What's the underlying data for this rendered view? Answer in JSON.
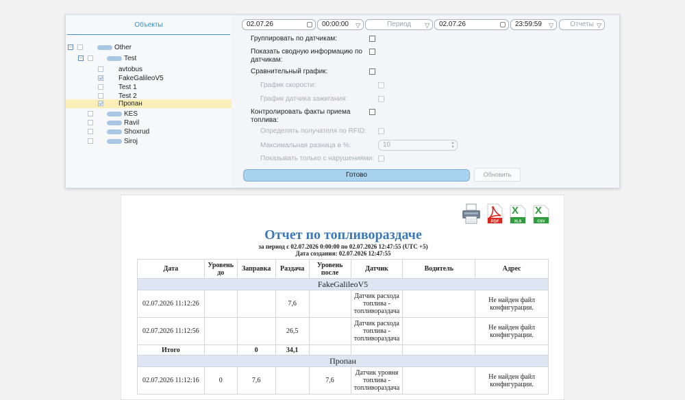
{
  "tree": {
    "tab_label": "Объекты",
    "items": [
      {
        "label": "Other",
        "level": 0,
        "expander": "⊟",
        "checked": false,
        "group": true
      },
      {
        "label": "Test",
        "level": 1,
        "expander": "⊟",
        "checked": false,
        "group": true
      },
      {
        "label": "avtobus",
        "level": 2,
        "checked": false,
        "group": false
      },
      {
        "label": "FakeGalileoV5",
        "level": 2,
        "checked": true,
        "group": false
      },
      {
        "label": "Test 1",
        "level": 2,
        "checked": false,
        "group": false
      },
      {
        "label": "Test 2",
        "level": 2,
        "checked": false,
        "group": false
      },
      {
        "label": "Пропан",
        "level": 2,
        "checked": true,
        "group": false,
        "selected": true
      },
      {
        "label": "KES",
        "level": 1,
        "checked": false,
        "group": true
      },
      {
        "label": "Ravil",
        "level": 1,
        "checked": false,
        "group": true
      },
      {
        "label": "Shoxrud",
        "level": 1,
        "checked": false,
        "group": true
      },
      {
        "label": "Siroj",
        "level": 1,
        "checked": false,
        "group": true
      }
    ]
  },
  "filters": {
    "date_from": "02.07.26",
    "time_from": "00:00:00",
    "period_placeholder": "Период",
    "date_to": "02.07.26",
    "time_to": "23:59:59",
    "reports_placeholder": "Отчеты"
  },
  "options": {
    "group_by_sensors": "Группировать по датчикам:",
    "summary": "Показать сводную информацию по датчикам:",
    "compare_chart": "Сравнительный график:",
    "speed_chart": "График скорости:",
    "ignition_chart": "График датчика зажигания:",
    "control_fuel": "Контролировать факты приема топлива:",
    "rfid_receiver": "Определять получателя по RFID:",
    "max_diff": "Максимальная разница в %:",
    "max_diff_value": "10",
    "violations_only": "Показывать только с нарушениями:",
    "ready_button": "Готово",
    "refresh_button": "Обновить"
  },
  "report": {
    "title": "Отчет по топливораздаче",
    "period": "за период с 02.07.2026 0:00:00 по 02.07.2026 12:47:55 (UTC +5)",
    "created": "Дата создания: 02.07.2026 12:47:55",
    "export_icons": [
      "printer-icon",
      "pdf-icon",
      "xls-icon",
      "csv-icon"
    ],
    "columns": [
      "Дата",
      "Уровень до",
      "Заправка",
      "Раздача",
      "Уровень после",
      "Датчик",
      "Водитель",
      "Адрес"
    ],
    "groups": [
      {
        "name": "FakeGalileoV5",
        "rows": [
          [
            "02.07.2026 11:12:26",
            "",
            "",
            "7,6",
            "",
            "Датчик расхода топлива - топливораздача",
            "",
            "Не найден файл конфигурации."
          ],
          [
            "02.07.2026 11:12:56",
            "",
            "",
            "26,5",
            "",
            "Датчик расхода топлива - топливораздача",
            "",
            "Не найден файл конфигурации."
          ]
        ],
        "total": [
          "Итого",
          "",
          "0",
          "34,1",
          "",
          "",
          "",
          ""
        ]
      },
      {
        "name": "Пропан",
        "rows": [
          [
            "02.07.2026 11:12:16",
            "0",
            "7,6",
            "",
            "7,6",
            "Датчик уровня топлива - топливораздача",
            "",
            "Не найден файл конфигурации."
          ]
        ]
      }
    ]
  }
}
